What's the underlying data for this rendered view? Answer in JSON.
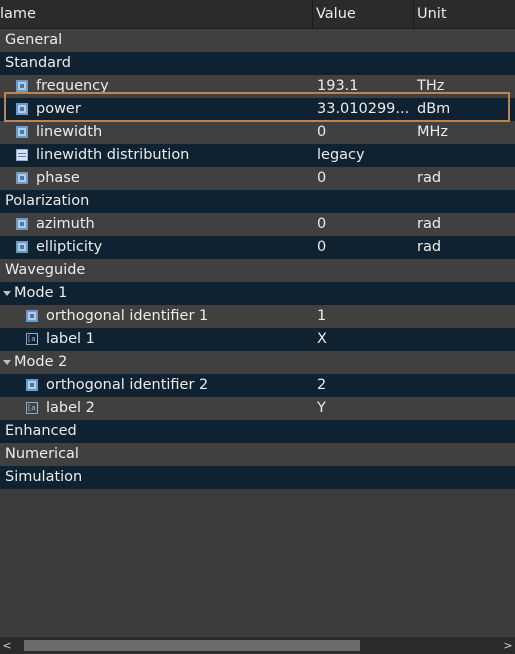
{
  "header": {
    "name": "lame",
    "value": "Value",
    "unit": "Unit"
  },
  "rows": {
    "general": "General",
    "standard": "Standard",
    "frequency": {
      "name": "frequency",
      "value": "193.1",
      "unit": "THz"
    },
    "power": {
      "name": "power",
      "value": "33.010299...",
      "unit": "dBm"
    },
    "linewidth": {
      "name": "linewidth",
      "value": "0",
      "unit": "MHz"
    },
    "linewidth_distribution": {
      "name": "linewidth distribution",
      "value": "legacy"
    },
    "phase": {
      "name": "phase",
      "value": "0",
      "unit": "rad"
    },
    "polarization": "Polarization",
    "azimuth": {
      "name": "azimuth",
      "value": "0",
      "unit": "rad"
    },
    "ellipticity": {
      "name": "ellipticity",
      "value": "0",
      "unit": "rad"
    },
    "waveguide": "Waveguide",
    "mode1": "Mode 1",
    "orth1": {
      "name": "orthogonal identifier 1",
      "value": "1"
    },
    "label1": {
      "name": "label 1",
      "value": "X"
    },
    "mode2": "Mode 2",
    "orth2": {
      "name": "orthogonal identifier 2",
      "value": "2"
    },
    "label2": {
      "name": "label 2",
      "value": "Y"
    },
    "enhanced": "Enhanced",
    "numerical": "Numerical",
    "simulation": "Simulation"
  },
  "icons": {
    "label_glyph": "[a]",
    "scroll_left": "<",
    "scroll_right": ">"
  },
  "colors": {
    "highlight": "#c0834f",
    "row_dark": "#0e2231",
    "row_grey": "#404040"
  }
}
